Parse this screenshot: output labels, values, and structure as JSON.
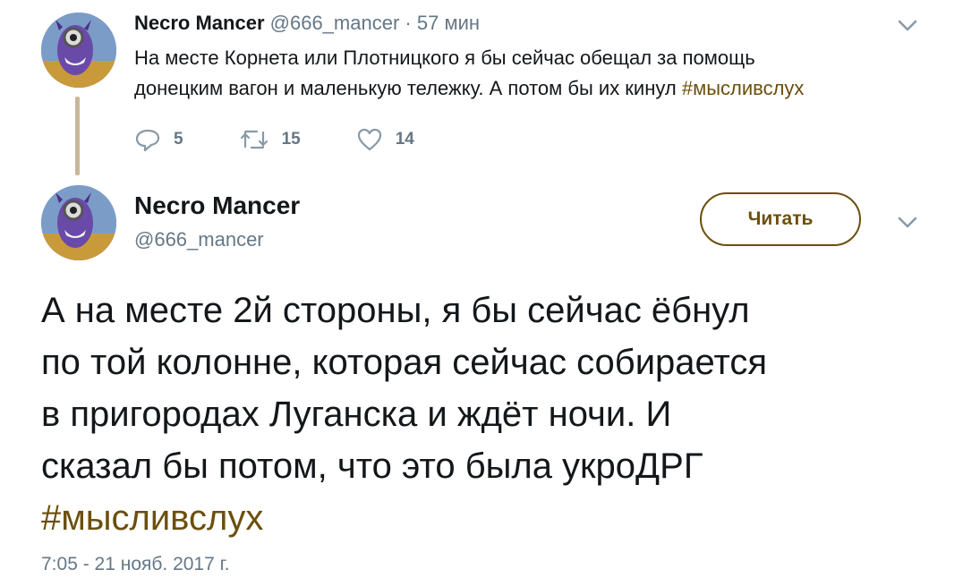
{
  "reply_tweet": {
    "author_name": "Necro Mancer",
    "handle": "@666_mancer",
    "separator": "·",
    "time_ago": "57 мин",
    "text_line1": "На месте Корнета или Плотницкого я бы сейчас обещал за помощь",
    "text_line2": "донецким вагон и маленькую тележку. А потом бы их кинул ",
    "hashtag": "#мысливслух",
    "actions": {
      "replies": "5",
      "retweets": "15",
      "likes": "14"
    }
  },
  "main_tweet": {
    "author_name": "Necro Mancer",
    "handle": "@666_mancer",
    "follow_label": "Читать",
    "lines": [
      "А на месте 2й стороны, я бы сейчас ёбнул",
      "по той колонне, которая сейчас собирается",
      "в пригородах Луганска и ждёт ночи. И",
      "сказал бы потом, что это была укроДРГ"
    ],
    "hashtag": "#мысливслух",
    "timestamp": "7:05 - 21 нояб. 2017 г."
  },
  "colors": {
    "accent": "#6b4f0b",
    "secondary_text": "#657786",
    "thread_line": "#c9b79c"
  }
}
